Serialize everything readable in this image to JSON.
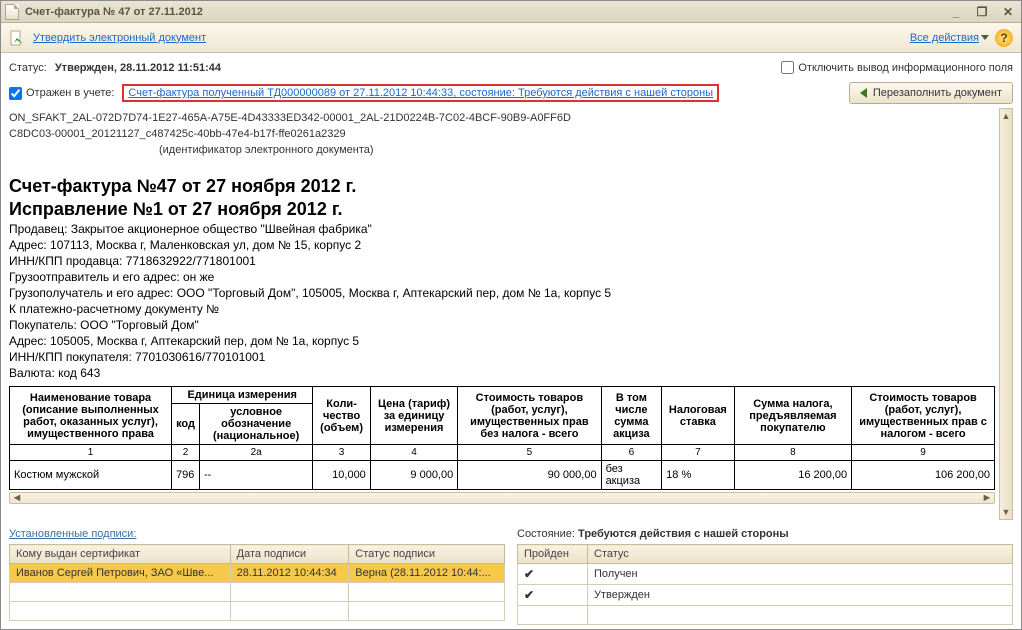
{
  "window": {
    "title": "Счет-фактура № 47 от 27.11.2012"
  },
  "toolbar": {
    "approve": "Утвердить электронный документ",
    "all_actions": "Все действия"
  },
  "status_row": {
    "label": "Статус:",
    "value": "Утвержден, 28.11.2012 11:51:44",
    "disable_info_label": "Отключить вывод информационного поля"
  },
  "accounting_row": {
    "label": "Отражен в учете:",
    "link": "Счет-фактура полученный ТД000000089 от 27.11.2012 10:44:33, состояние: Требуются действия с нашей стороны",
    "refill_btn": "Перезаполнить документ"
  },
  "doc_id_lines": [
    "ON_SFAKT_2AL-072D7D74-1E27-465A-A75E-4D43333ED342-00001_2AL-21D0224B-7C02-4BCF-90B9-A0FF6D",
    "C8DC03-00001_20121127_c487425c-40bb-47e4-b17f-ffe0261a2329"
  ],
  "doc_id_caption": "(идентификатор электронного документа)",
  "doc": {
    "h1": "Счет-фактура №47 от 27 ноября 2012 г.",
    "h2": "Исправление №1 от 27 ноября 2012 г.",
    "lines": [
      "Продавец: Закрытое акционерное общество \"Швейная фабрика\"",
      "Адрес: 107113, Москва г, Маленковская ул, дом № 15, корпус 2",
      "ИНН/КПП продавца: 7718632922/771801001",
      "Грузоотправитель и его адрес: он же",
      "Грузополучатель и его адрес: ООО \"Торговый Дом\", 105005, Москва г, Аптекарский пер, дом № 1а, корпус 5",
      "К платежно-расчетному документу №",
      "Покупатель: ООО \"Торговый Дом\"",
      "Адрес: 105005, Москва г, Аптекарский пер, дом № 1а, корпус 5",
      "ИНН/КПП покупателя: 7701030616/770101001",
      "Валюта: код 643"
    ],
    "headers": {
      "name": "Наименование товара (описание выполненных работ, оказанных услуг), имущественного права",
      "unit": "Единица измерения",
      "unit_code": "код",
      "unit_label": "условное обозначение (национальное)",
      "qty": "Коли-\nчество (объем)",
      "price": "Цена (тариф) за единицу измерения",
      "cost_no_tax": "Стоимость товаров (работ, услуг), имущественных прав без налога - всего",
      "excise": "В том числе сумма акциза",
      "tax_rate": "Налоговая ставка",
      "tax_sum": "Сумма налога, предъявляемая покупателю",
      "cost_with_tax": "Стоимость товаров (работ, услуг), имущественных прав с налогом - всего"
    },
    "num_row": [
      "1",
      "2",
      "2а",
      "3",
      "4",
      "5",
      "6",
      "7",
      "8",
      "9"
    ],
    "rows": [
      {
        "name": "Костюм мужской",
        "code": "796",
        "unit": "--",
        "qty": "10,000",
        "price": "9 000,00",
        "cost_no_tax": "90 000,00",
        "excise": "без акциза",
        "tax_rate": "18 %",
        "tax_sum": "16 200,00",
        "cost_with_tax": "106 200,00"
      }
    ]
  },
  "signatures": {
    "title": "Установленные подписи:",
    "headers": {
      "to": "Кому выдан сертификат",
      "date": "Дата подписи",
      "status": "Статус подписи"
    },
    "rows": [
      {
        "to": "Иванов Сергей Петрович, ЗАО «Шве...",
        "date": "28.11.2012 10:44:34",
        "status": "Верна (28.11.2012 10:44:..."
      }
    ]
  },
  "state": {
    "label": "Состояние:",
    "value": "Требуются действия с нашей стороны",
    "headers": {
      "passed": "Пройден",
      "status": "Статус"
    },
    "rows": [
      {
        "passed": true,
        "status": "Получен"
      },
      {
        "passed": true,
        "status": "Утвержден"
      }
    ]
  }
}
